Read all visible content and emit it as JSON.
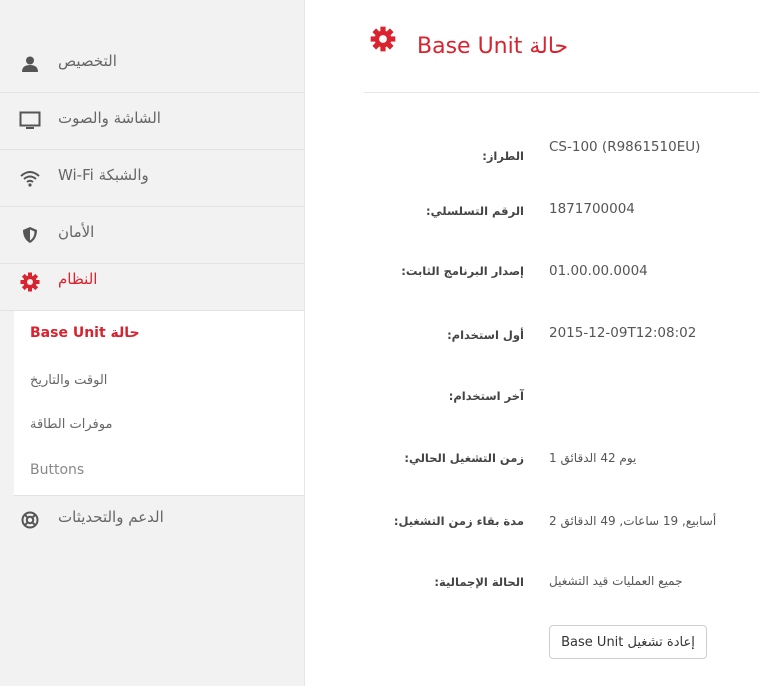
{
  "sidebar": {
    "items": [
      {
        "label": "التخصيص",
        "icon": "user-icon"
      },
      {
        "label": "الشاشة والصوت",
        "icon": "monitor-icon"
      },
      {
        "label": "Wi-Fi والشبكة",
        "icon": "wifi-icon"
      },
      {
        "label": "الأمان",
        "icon": "shield-icon"
      },
      {
        "label": "النظام",
        "icon": "gear-icon"
      },
      {
        "label": "الدعم والتحديثات",
        "icon": "lifebuoy-icon"
      }
    ],
    "submenu": [
      {
        "label": "Base Unit حالة"
      },
      {
        "label": "الوقت والتاريخ"
      },
      {
        "label": "موفرات الطاقة"
      },
      {
        "label": "Buttons"
      }
    ]
  },
  "main": {
    "title": "Base Unit حالة",
    "title_icon": "gear-icon",
    "rows": [
      {
        "label": ":الطراز",
        "value": "CS-100 (R9861510EU)"
      },
      {
        "label": ":الرقم التسلسلي",
        "value": "1871700004"
      },
      {
        "label": ":إصدار البرنامج الثابت",
        "value": "01.00.00.0004"
      },
      {
        "label": ":أول استخدام",
        "value": "2015-12-09T12:08:02"
      },
      {
        "label": ":آخر استخدام",
        "value": ""
      },
      {
        "label": ":زمن التشغيل الحالي",
        "value": "يوم 42 الدقائق 1"
      },
      {
        "label": ":مدة بقاء زمن التشغيل",
        "value": "أسابيع, 19 ساعات, 49 الدقائق 2"
      },
      {
        "label": ":الحالة الإجمالية",
        "value": "جميع العمليات قيد التشغيل"
      }
    ],
    "restart_button": "Base Unit إعادة تشغيل"
  },
  "colors": {
    "accent": "#d9232e",
    "sidebar_bg": "#f2f2f2"
  }
}
